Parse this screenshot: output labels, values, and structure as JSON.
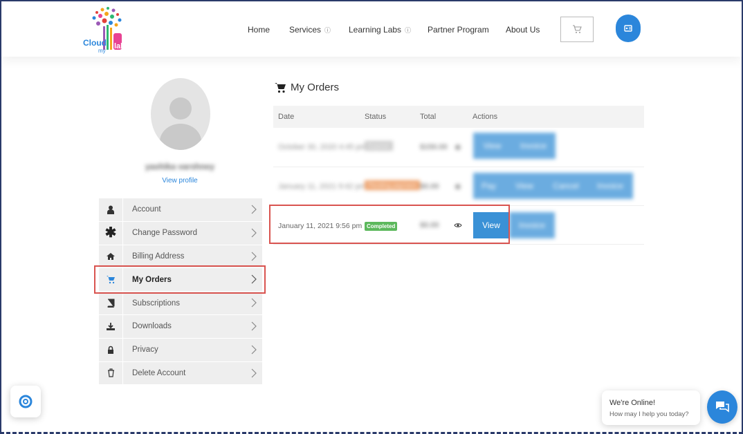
{
  "header": {
    "logo_text": "Cloud my lab",
    "nav": [
      {
        "label": "Home",
        "has_info": false
      },
      {
        "label": "Services",
        "has_info": true,
        "info_icon": "ⓘ"
      },
      {
        "label": "Learning Labs",
        "has_info": true,
        "info_icon": "ⓘ"
      },
      {
        "label": "Partner Program",
        "has_info": false
      },
      {
        "label": "About Us",
        "has_info": false
      }
    ],
    "cart_icon": "cart-icon",
    "user_icon": "user-card-icon",
    "accent_color": "#2b86db"
  },
  "profile": {
    "name": "yashika varshney",
    "view_profile_label": "View profile"
  },
  "sidebar": {
    "items": [
      {
        "label": "Account",
        "icon": "user-icon",
        "active": false
      },
      {
        "label": "Change Password",
        "icon": "asterisk-icon",
        "active": false
      },
      {
        "label": "Billing Address",
        "icon": "home-icon",
        "active": false
      },
      {
        "label": "My Orders",
        "icon": "cart-icon",
        "active": true
      },
      {
        "label": "Subscriptions",
        "icon": "book-icon",
        "active": false
      },
      {
        "label": "Downloads",
        "icon": "download-icon",
        "active": false
      },
      {
        "label": "Privacy",
        "icon": "lock-icon",
        "active": false
      },
      {
        "label": "Delete Account",
        "icon": "trash-icon",
        "active": false
      }
    ]
  },
  "orders": {
    "title": "My Orders",
    "columns": [
      "Date",
      "Status",
      "Total",
      "Actions"
    ],
    "rows": [
      {
        "date": "October 30, 2020 4:45 pm",
        "status": "Expired",
        "total": "$150.00",
        "actions": [
          "View",
          "Invoice"
        ],
        "blurred": true
      },
      {
        "date": "January 11, 2021 9:42 pm",
        "status": "Pending payment",
        "total": "$0.00",
        "actions": [
          "Pay",
          "View",
          "Cancel",
          "Invoice"
        ],
        "blurred": true
      },
      {
        "date": "January 11, 2021 9:56 pm",
        "status": "Completed",
        "total": "$0.00",
        "actions": [
          "View",
          "Invoice"
        ],
        "blurred": false
      }
    ]
  },
  "chat": {
    "title": "We're Online!",
    "subtitle": "How may I help you today?"
  },
  "colors": {
    "completed": "#5cb85c",
    "pending": "#e8823a",
    "button": "#3a91d6",
    "highlight": "#d9534f"
  }
}
